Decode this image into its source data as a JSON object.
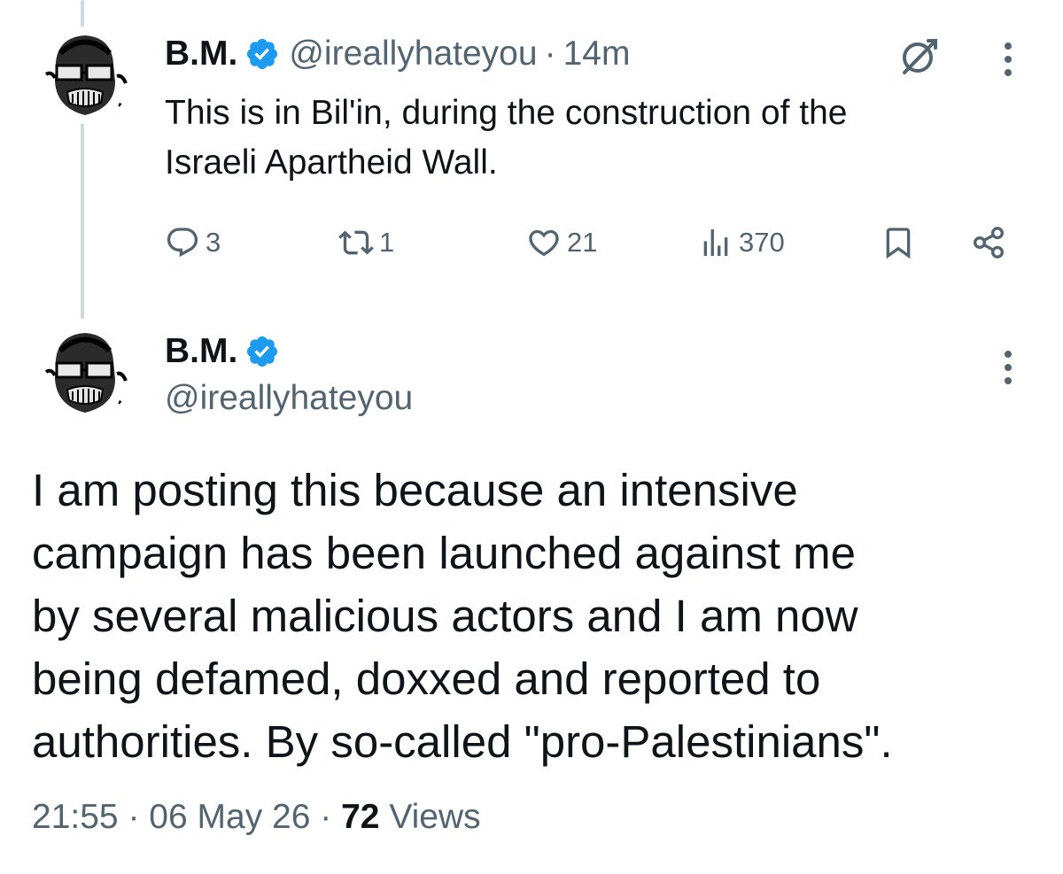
{
  "tweet1": {
    "name": "B.M.",
    "handle": "@ireallyhateyou",
    "separator": "·",
    "time": "14m",
    "text_line1": "This is in Bil'in, during the construction of the",
    "text_line2": "Israeli Apartheid Wall.",
    "replies": "3",
    "reposts": "1",
    "likes": "21",
    "views": "370"
  },
  "tweet2": {
    "name": "B.M.",
    "handle": "@ireallyhateyou",
    "text_lines": [
      "I am posting this because an intensive",
      "campaign has been launched against me",
      "by several malicious actors and I am now",
      "being defamed, doxxed and reported to",
      "authorities. By so-called \"pro-Palestinians\"."
    ],
    "time": "21:55",
    "date": "06 May 26",
    "separator": "·",
    "views_count": "72",
    "views_label": "Views"
  },
  "colors": {
    "text": "#0f1419",
    "muted": "#536471",
    "verified": "#1d9bf0",
    "thread_line": "#cfd9de"
  },
  "icons": [
    "verified-badge-icon",
    "grok-icon",
    "more-icon",
    "reply-icon",
    "repost-icon",
    "like-icon",
    "views-icon",
    "bookmark-icon",
    "share-icon"
  ]
}
